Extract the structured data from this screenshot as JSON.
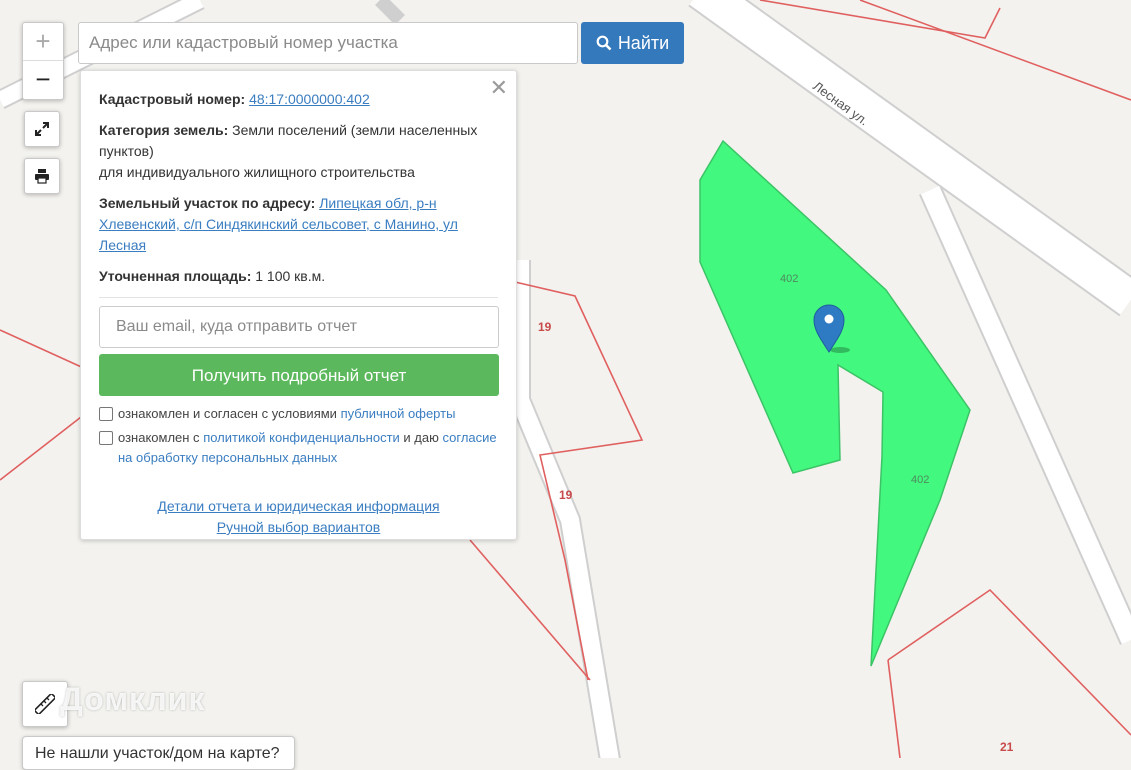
{
  "map": {
    "street_label": "Лесная ул.",
    "parcel_labels": [
      "402",
      "402",
      "19",
      "19",
      "21"
    ],
    "parcel_color": "#43f87e",
    "boundary_color": "#e06060",
    "marker_color": "#2e7bc4"
  },
  "controls": {
    "zoom_in": "+",
    "zoom_out": "−",
    "fullscreen_icon": "expand-arrows-icon",
    "print_icon": "printer-icon",
    "ruler_icon": "ruler-icon"
  },
  "search": {
    "placeholder": "Адрес или кадастровый номер участка",
    "button_label": "Найти"
  },
  "panel": {
    "cadastral_label": "Кадастровый номер:",
    "cadastral_value": "48:17:0000000:402",
    "category_label": "Категория земель:",
    "category_value_1": "Земли поселений (земли населенных пунктов)",
    "category_value_2": "для индивидуального жилищного строительства",
    "address_label": "Земельный участок по адресу:",
    "address_value": "Липецкая обл, р-н Хлевенский, с/п Синдякинский сельсовет, с Манино, ул Лесная",
    "area_label": "Уточненная площадь:",
    "area_value": "1 100 кв.м.",
    "email_placeholder": "Ваш email, куда отправить отчет",
    "report_button": "Получить подробный отчет",
    "check1_text": "ознакомлен и согласен с условиями",
    "check1_link": "публичной оферты",
    "check2_text": "ознакомлен с",
    "check2_link": "политикой конфиденциальности",
    "check2_text2": "и даю",
    "check2_link2": "согласие на обработку персональных данных",
    "link_details": "Детали отчета и юридическая информация",
    "link_manual": "Ручной выбор вариантов"
  },
  "logo_text": "Домклик",
  "not_found": "Не нашли участок/дом на карте?"
}
